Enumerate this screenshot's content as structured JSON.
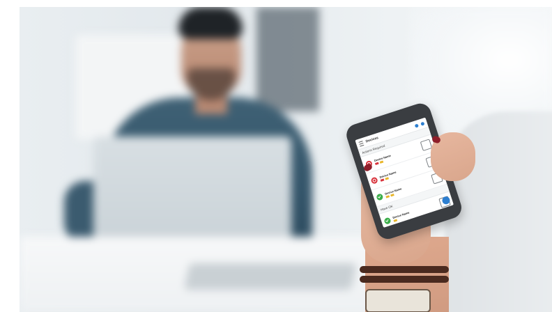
{
  "scene": {
    "description_color_accent": "#2d7fd0",
    "phone_app": {
      "header_title": "Devices",
      "sections": [
        {
          "label": "Actions Required"
        },
        {
          "label": "Have OK"
        }
      ],
      "rows": [
        {
          "name": "Device Name",
          "status": "alert",
          "status_color": "#d8323b"
        },
        {
          "name": "Device Name",
          "status": "alert",
          "status_color": "#d8323b"
        },
        {
          "name": "Device Name",
          "status": "ok",
          "status_color": "#3cae4b"
        },
        {
          "name": "Device Name",
          "status": "ok",
          "status_color": "#3cae4b"
        }
      ]
    }
  }
}
